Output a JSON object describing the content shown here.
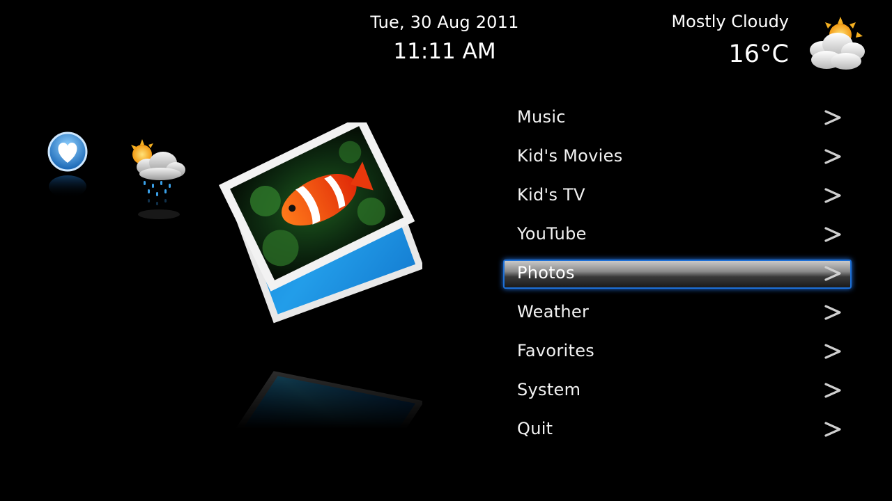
{
  "header": {
    "date": "Tue, 30 Aug 2011",
    "time": "11:11 AM"
  },
  "weather": {
    "condition": "Mostly Cloudy",
    "temperature": "16°C",
    "icon": "partly-cloudy-icon"
  },
  "shortcuts": [
    {
      "icon": "heart-icon",
      "color": "#3b8fd8"
    },
    {
      "icon": "rain-cloud-icon"
    }
  ],
  "preview": {
    "icon": "photos-icon"
  },
  "menu": {
    "selected_index": 4,
    "accent_color": "#1c6fd6",
    "items": [
      {
        "label": "Music"
      },
      {
        "label": "Kid's Movies"
      },
      {
        "label": "Kid's TV"
      },
      {
        "label": "YouTube"
      },
      {
        "label": "Photos"
      },
      {
        "label": "Weather"
      },
      {
        "label": "Favorites"
      },
      {
        "label": "System"
      },
      {
        "label": "Quit"
      }
    ]
  }
}
